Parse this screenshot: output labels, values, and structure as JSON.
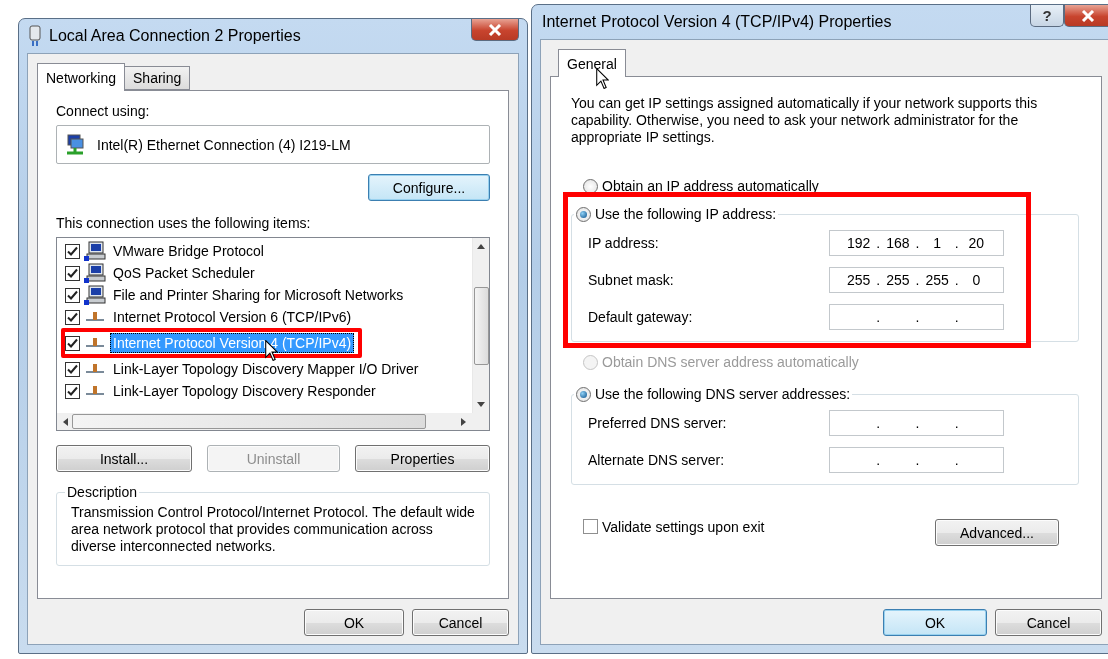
{
  "left_window": {
    "title": "Local Area Connection 2 Properties",
    "tabs": [
      {
        "label": "Networking",
        "selected": true
      },
      {
        "label": "Sharing",
        "selected": false
      }
    ],
    "connect_using_label": "Connect using:",
    "adapter": "Intel(R) Ethernet Connection (4) I219-LM",
    "configure_button": "Configure...",
    "items_label": "This connection uses the following items:",
    "items": [
      {
        "label": "VMware Bridge Protocol",
        "kind": "client",
        "checked": true,
        "selected": false,
        "highlighted": false
      },
      {
        "label": "QoS Packet Scheduler",
        "kind": "client",
        "checked": true,
        "selected": false,
        "highlighted": false
      },
      {
        "label": "File and Printer Sharing for Microsoft Networks",
        "kind": "client",
        "checked": true,
        "selected": false,
        "highlighted": false
      },
      {
        "label": "Internet Protocol Version 6 (TCP/IPv6)",
        "kind": "protocol",
        "checked": true,
        "selected": false,
        "highlighted": false
      },
      {
        "label": "Internet Protocol Version 4 (TCP/IPv4)",
        "kind": "protocol",
        "checked": true,
        "selected": true,
        "highlighted": true
      },
      {
        "label": "Link-Layer Topology Discovery Mapper I/O Driver",
        "kind": "protocol",
        "checked": true,
        "selected": false,
        "highlighted": false
      },
      {
        "label": "Link-Layer Topology Discovery Responder",
        "kind": "protocol",
        "checked": true,
        "selected": false,
        "highlighted": false
      }
    ],
    "action_buttons": [
      {
        "label": "Install...",
        "disabled": false
      },
      {
        "label": "Uninstall",
        "disabled": true
      },
      {
        "label": "Properties",
        "disabled": false
      }
    ],
    "description": {
      "title": "Description",
      "text": "Transmission Control Protocol/Internet Protocol. The default wide area network protocol that provides communication across diverse interconnected networks."
    },
    "buttons": [
      {
        "label": "OK",
        "default": false
      },
      {
        "label": "Cancel",
        "default": false
      }
    ]
  },
  "right_window": {
    "title": "Internet Protocol Version 4 (TCP/IPv4) Properties",
    "help_button": "?",
    "tabs": [
      {
        "label": "General",
        "selected": true
      }
    ],
    "intro": "You can get IP settings assigned automatically if your network supports this capability. Otherwise, you need to ask your network administrator for the appropriate IP settings.",
    "ip_separator": ".",
    "ip_auto": {
      "label": "Obtain an IP address automatically",
      "selected": false,
      "disabled": false
    },
    "ip_manual": {
      "label": "Use the following IP address:",
      "selected": true,
      "disabled": false,
      "highlighted": true,
      "fields": [
        {
          "label": "IP address:",
          "octets": [
            "192",
            "168",
            "1",
            "20"
          ]
        },
        {
          "label": "Subnet mask:",
          "octets": [
            "255",
            "255",
            "255",
            "0"
          ]
        },
        {
          "label": "Default gateway:"
        }
      ]
    },
    "dns_auto": {
      "label": "Obtain DNS server address automatically",
      "selected": false,
      "disabled": true
    },
    "dns_manual": {
      "label": "Use the following DNS server addresses:",
      "selected": true,
      "disabled": false,
      "fields": [
        {
          "label": "Preferred DNS server:"
        },
        {
          "label": "Alternate DNS server:"
        }
      ]
    },
    "validate": {
      "label": "Validate settings upon exit",
      "checked": false
    },
    "advanced_button": "Advanced...",
    "buttons": [
      {
        "label": "OK",
        "default": true
      },
      {
        "label": "Cancel",
        "default": false
      }
    ]
  }
}
